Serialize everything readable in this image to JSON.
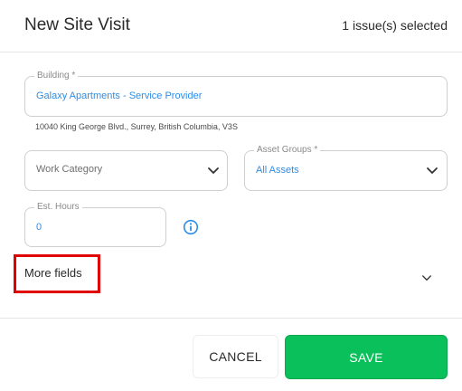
{
  "header": {
    "title": "New Site Visit",
    "selection_count": "1 issue(s) selected"
  },
  "form": {
    "building": {
      "label": "Building *",
      "value": "Galaxy Apartments - Service Provider",
      "address": "10040 King George Blvd., Surrey, British Columbia, V3S"
    },
    "work_category": {
      "placeholder": "Work Category"
    },
    "asset_groups": {
      "label": "Asset Groups *",
      "value": "All Assets"
    },
    "est_hours": {
      "label": "Est. Hours",
      "value": "0"
    },
    "more_fields_label": "More fields"
  },
  "footer": {
    "cancel_label": "CANCEL",
    "save_label": "SAVE"
  },
  "colors": {
    "accent_blue": "#2f8de4",
    "save_green": "#0ac05a",
    "highlight_red": "#e00000"
  },
  "icons": [
    "chevron-down-icon",
    "info-icon"
  ]
}
